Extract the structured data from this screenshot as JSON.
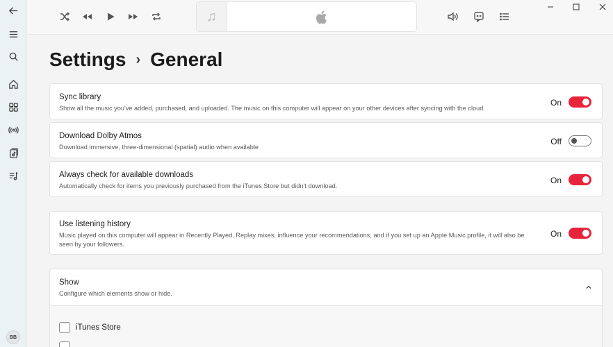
{
  "sidebar": {
    "items": [
      {
        "icon": "back-arrow-icon"
      },
      {
        "icon": "menu-icon"
      },
      {
        "icon": "search-icon"
      },
      {
        "icon": "home-icon"
      },
      {
        "icon": "browse-grid-icon"
      },
      {
        "icon": "radio-icon"
      },
      {
        "icon": "library-icon"
      },
      {
        "icon": "playlist-icon"
      }
    ],
    "avatar_initials": "BB"
  },
  "toolbar": {
    "controls": [
      "shuffle-icon",
      "previous-icon",
      "play-icon",
      "next-icon",
      "repeat-icon"
    ],
    "right_controls": [
      "volume-icon",
      "lyrics-icon",
      "queue-icon"
    ]
  },
  "page": {
    "title": "Settings",
    "separator": "›",
    "subtitle": "General"
  },
  "settings": [
    {
      "title": "Sync library",
      "description": "Show all the music you've added, purchased, and uploaded. The music on this computer will appear on your other devices after syncing with the cloud.",
      "state": "On"
    },
    {
      "title": "Download Dolby Atmos",
      "description": "Download immersive, three-dimensional (spatial) audio when available",
      "state": "Off"
    },
    {
      "title": "Always check for available downloads",
      "description": "Automatically check for items you previously purchased from the iTunes Store but didn't download.",
      "state": "On"
    },
    {
      "title": "Use listening history",
      "description": "Music played on this computer will appear in Recently Played, Replay mixes, influence your recommendations, and if you set up an Apple Music profile, it will also be seen by your followers.",
      "state": "On"
    }
  ],
  "show_section": {
    "title": "Show",
    "description": "Configure which elements show or hide.",
    "items": [
      {
        "label": "iTunes Store",
        "checked": false
      }
    ]
  },
  "colors": {
    "accent": "#e8243c",
    "sidebar_bg": "#eaf2f3",
    "page_bg": "#f4f4f4"
  }
}
